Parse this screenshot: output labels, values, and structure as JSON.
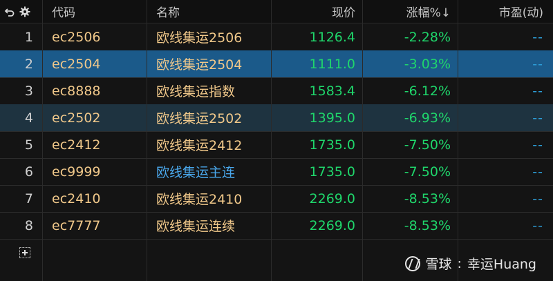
{
  "header": {
    "columns": [
      "代码",
      "名称",
      "现价",
      "涨幅%↓",
      "市盈(动)"
    ]
  },
  "rows": [
    {
      "index": "1",
      "code": "ec2506",
      "name": "欧线集运2506",
      "price": "1126.4",
      "change": "-2.28%",
      "pe": "--"
    },
    {
      "index": "2",
      "code": "ec2504",
      "name": "欧线集运2504",
      "price": "1111.0",
      "change": "-3.03%",
      "pe": "--"
    },
    {
      "index": "3",
      "code": "ec8888",
      "name": "欧线集运指数",
      "price": "1583.4",
      "change": "-6.12%",
      "pe": "--"
    },
    {
      "index": "4",
      "code": "ec2502",
      "name": "欧线集运2502",
      "price": "1395.0",
      "change": "-6.93%",
      "pe": "--"
    },
    {
      "index": "5",
      "code": "ec2412",
      "name": "欧线集运2412",
      "price": "1735.0",
      "change": "-7.50%",
      "pe": "--"
    },
    {
      "index": "6",
      "code": "ec9999",
      "name": "欧线集运主连",
      "price": "1735.0",
      "change": "-7.50%",
      "pe": "--"
    },
    {
      "index": "7",
      "code": "ec2410",
      "name": "欧线集运2410",
      "price": "2269.0",
      "change": "-8.53%",
      "pe": "--"
    },
    {
      "index": "8",
      "code": "ec7777",
      "name": "欧线集运连续",
      "price": "2269.0",
      "change": "-8.53%",
      "pe": "--"
    }
  ],
  "watermark": {
    "brand": "雪球",
    "separator": ":",
    "author": "幸运Huang"
  },
  "icons": {
    "undo": "undo-icon",
    "settings": "gear-icon",
    "add": "add-row-icon"
  },
  "colors": {
    "background": "#141414",
    "selected_row": "#1b5a8a",
    "highlight_row": "#1e3340",
    "code_text": "#f0c88a",
    "main_contract_text": "#4aa8ec",
    "down_green": "#1fd66b",
    "pe_text": "#2d9ed8"
  }
}
